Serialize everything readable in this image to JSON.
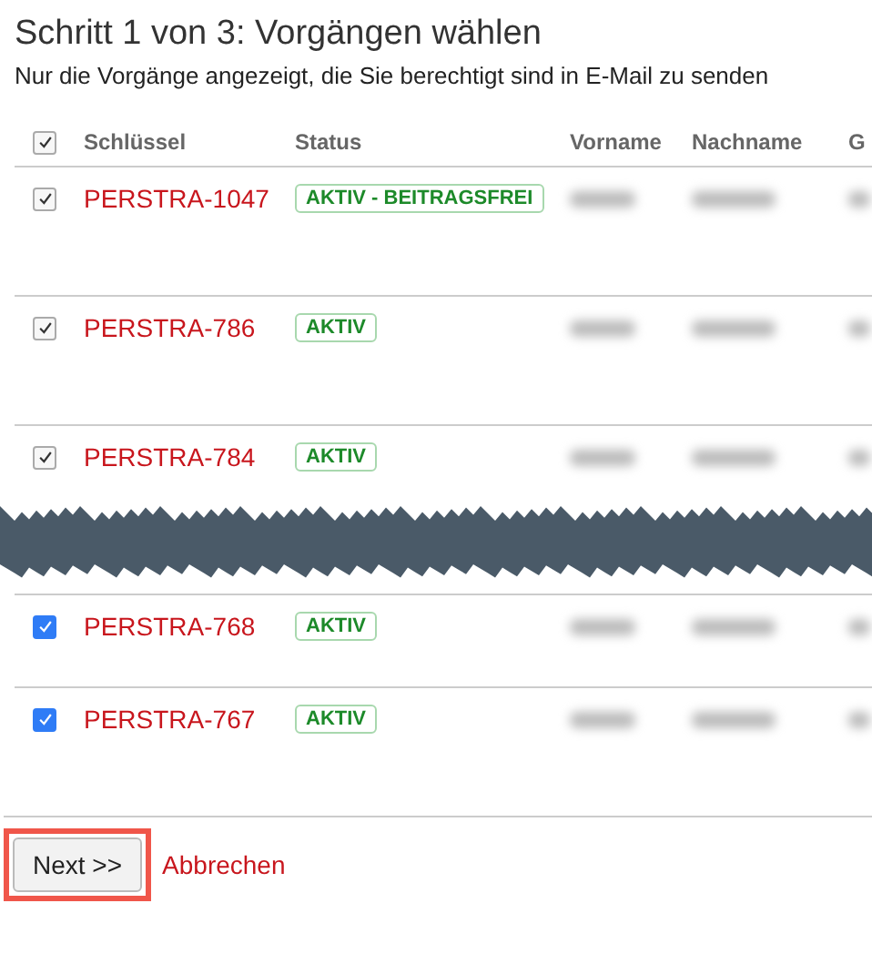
{
  "title": "Schritt 1 von 3: Vorgängen wählen",
  "subtitle": "Nur die Vorgänge angezeigt, die Sie berechtigt sind in E-Mail zu senden",
  "table": {
    "header_checkbox": {
      "checked": true,
      "disabled": true
    },
    "columns": [
      "Schlüssel",
      "Status",
      "Vorname",
      "Nachname",
      "G"
    ],
    "rows": [
      {
        "kind": "row",
        "key": "PERSTRA-1047",
        "status": "AKTIV - BEITRAGSFREI",
        "checked": true,
        "disabled": true
      },
      {
        "kind": "row",
        "key": "PERSTRA-786",
        "status": "AKTIV",
        "checked": true,
        "disabled": true
      },
      {
        "kind": "row",
        "key": "PERSTRA-784",
        "status": "AKTIV",
        "checked": true,
        "disabled": true
      },
      {
        "kind": "tear"
      },
      {
        "kind": "row",
        "key": "PERSTRA-768",
        "status": "AKTIV",
        "checked": true,
        "disabled": false
      },
      {
        "kind": "row",
        "key": "PERSTRA-767",
        "status": "AKTIV",
        "checked": true,
        "disabled": false
      }
    ]
  },
  "buttons": {
    "next": "Next >>",
    "cancel": "Abbrechen",
    "next_highlighted": true
  }
}
